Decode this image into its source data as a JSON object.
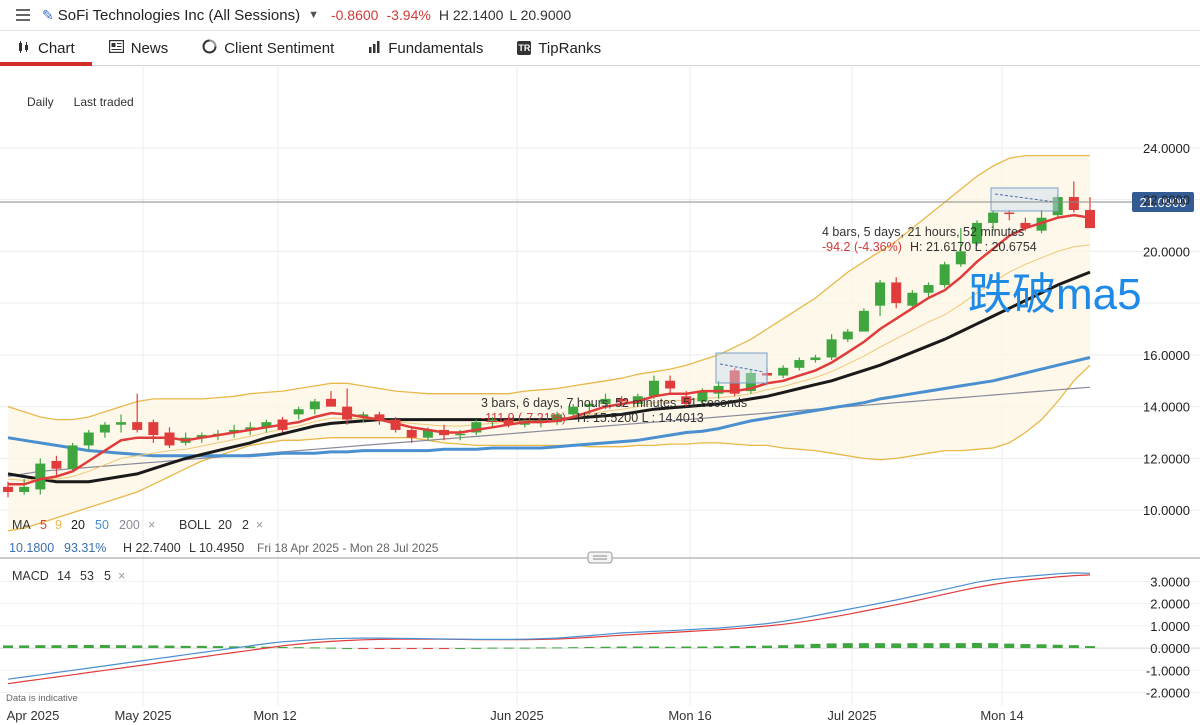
{
  "header": {
    "title": "SoFi Technologies Inc (All Sessions)",
    "change": "-0.8600",
    "change_pct": "-3.94%",
    "high": "H 22.1400",
    "low": "L 20.9000"
  },
  "tabs": [
    {
      "label": "Chart",
      "icon": "candlestick-icon"
    },
    {
      "label": "News",
      "icon": "newspaper-icon"
    },
    {
      "label": "Client Sentiment",
      "icon": "sentiment-gauge-icon"
    },
    {
      "label": "Fundamentals",
      "icon": "bar-chart-icon"
    },
    {
      "label": "TipRanks",
      "icon": "tipranks-logo-icon"
    }
  ],
  "controls": {
    "interval": "Daily",
    "price_type": "Last traded"
  },
  "price_label": "21.0900",
  "y_ticks": [
    "24.0000",
    "22.0000",
    "20.0000",
    "16.0000",
    "14.0000",
    "12.0000",
    "10.0000"
  ],
  "x_ticks": [
    "Apr 2025",
    "May 2025",
    "Mon 12",
    "Jun 2025",
    "Mon 16",
    "Jul 2025",
    "Mon 14"
  ],
  "legend": {
    "ma_label": "MA",
    "ma_periods": [
      "5",
      "9",
      "20",
      "50",
      "200"
    ],
    "boll_label": "BOLL",
    "boll_params": [
      "20",
      "2"
    ],
    "close": "×",
    "stats_a": "10.1800",
    "stats_b": "93.31%",
    "stats_high": "H 22.7400",
    "stats_low": "L 10.4950",
    "stats_range": "Fri 18 Apr 2025 - Mon 28 Jul 2025"
  },
  "annotations": {
    "measure1": {
      "line1": "3 bars, 6 days, 7 hours, 52 minutes, 51 seconds",
      "line2a": "-111.9 (-7.21%)",
      "line2b": "H: 15.5200 L : 14.4013"
    },
    "measure2": {
      "line1": "4 bars, 5 days, 21 hours, 52 minutes",
      "line2a": "-94.2 (-4.36%)",
      "line2b": "H: 21.6170 L : 20.6754"
    },
    "overlay": "跌破ma5"
  },
  "macd": {
    "label": "MACD",
    "params": [
      "14",
      "53",
      "5"
    ],
    "close": "×",
    "ticks": [
      "3.0000",
      "2.0000",
      "1.0000",
      "0.0000",
      "-1.0000",
      "-2.0000"
    ]
  },
  "footer_note": "Data is indicative",
  "chart_data": {
    "type": "candlestick",
    "price_ylim": [
      9,
      25
    ],
    "macd_ylim": [
      -2.2,
      3.6
    ],
    "colors": {
      "up": "#3fa63f",
      "down": "#e03c3c",
      "ma5": "#e03c3c",
      "ma9": "#e8b84a",
      "ma20": "#1a1a1a",
      "ma50": "#4a8fd0",
      "ma200": "#8a8a9a",
      "boll": "#e8b84a"
    },
    "candles": [
      {
        "o": 10.9,
        "h": 11.1,
        "l": 10.5,
        "c": 10.7
      },
      {
        "o": 10.7,
        "h": 11.2,
        "l": 10.6,
        "c": 10.9
      },
      {
        "o": 10.8,
        "h": 12.0,
        "l": 10.6,
        "c": 11.8
      },
      {
        "o": 11.9,
        "h": 12.1,
        "l": 11.3,
        "c": 11.6
      },
      {
        "o": 11.6,
        "h": 12.6,
        "l": 11.5,
        "c": 12.5
      },
      {
        "o": 12.5,
        "h": 13.1,
        "l": 12.3,
        "c": 13.0
      },
      {
        "o": 13.0,
        "h": 13.4,
        "l": 12.8,
        "c": 13.3
      },
      {
        "o": 13.3,
        "h": 13.7,
        "l": 13.0,
        "c": 13.4
      },
      {
        "o": 13.4,
        "h": 14.5,
        "l": 13.0,
        "c": 13.1
      },
      {
        "o": 13.4,
        "h": 13.5,
        "l": 12.6,
        "c": 12.9
      },
      {
        "o": 13.0,
        "h": 13.2,
        "l": 12.4,
        "c": 12.5
      },
      {
        "o": 12.6,
        "h": 13.0,
        "l": 12.5,
        "c": 12.8
      },
      {
        "o": 12.8,
        "h": 13.0,
        "l": 12.6,
        "c": 12.9
      },
      {
        "o": 12.9,
        "h": 13.1,
        "l": 12.7,
        "c": 12.95
      },
      {
        "o": 13.0,
        "h": 13.3,
        "l": 12.8,
        "c": 13.1
      },
      {
        "o": 13.1,
        "h": 13.4,
        "l": 12.9,
        "c": 13.2
      },
      {
        "o": 13.2,
        "h": 13.5,
        "l": 13.0,
        "c": 13.4
      },
      {
        "o": 13.5,
        "h": 13.6,
        "l": 13.0,
        "c": 13.1
      },
      {
        "o": 13.7,
        "h": 14.0,
        "l": 13.5,
        "c": 13.9
      },
      {
        "o": 13.9,
        "h": 14.3,
        "l": 13.7,
        "c": 14.2
      },
      {
        "o": 14.3,
        "h": 14.6,
        "l": 14.0,
        "c": 14.0
      },
      {
        "o": 14.0,
        "h": 14.7,
        "l": 13.3,
        "c": 13.5
      },
      {
        "o": 13.6,
        "h": 13.8,
        "l": 13.4,
        "c": 13.7
      },
      {
        "o": 13.7,
        "h": 13.8,
        "l": 13.3,
        "c": 13.5
      },
      {
        "o": 13.5,
        "h": 13.6,
        "l": 13.0,
        "c": 13.1
      },
      {
        "o": 13.1,
        "h": 13.2,
        "l": 12.6,
        "c": 12.8
      },
      {
        "o": 12.8,
        "h": 13.2,
        "l": 12.7,
        "c": 13.1
      },
      {
        "o": 13.1,
        "h": 13.3,
        "l": 12.7,
        "c": 12.9
      },
      {
        "o": 12.9,
        "h": 13.1,
        "l": 12.7,
        "c": 12.95
      },
      {
        "o": 13.0,
        "h": 13.5,
        "l": 12.9,
        "c": 13.4
      },
      {
        "o": 13.4,
        "h": 13.6,
        "l": 13.2,
        "c": 13.5
      },
      {
        "o": 13.5,
        "h": 13.6,
        "l": 13.2,
        "c": 13.3
      },
      {
        "o": 13.3,
        "h": 13.5,
        "l": 13.2,
        "c": 13.4
      },
      {
        "o": 13.4,
        "h": 13.5,
        "l": 13.2,
        "c": 13.45
      },
      {
        "o": 13.4,
        "h": 13.8,
        "l": 13.3,
        "c": 13.7
      },
      {
        "o": 13.7,
        "h": 14.1,
        "l": 13.6,
        "c": 14.0
      },
      {
        "o": 14.0,
        "h": 14.2,
        "l": 13.7,
        "c": 14.1
      },
      {
        "o": 14.1,
        "h": 14.5,
        "l": 13.9,
        "c": 14.3
      },
      {
        "o": 14.3,
        "h": 14.4,
        "l": 14.0,
        "c": 14.2
      },
      {
        "o": 14.1,
        "h": 14.5,
        "l": 14.0,
        "c": 14.4
      },
      {
        "o": 14.4,
        "h": 15.2,
        "l": 14.3,
        "c": 15.0
      },
      {
        "o": 15.0,
        "h": 15.2,
        "l": 14.5,
        "c": 14.7
      },
      {
        "o": 14.4,
        "h": 14.6,
        "l": 14.0,
        "c": 14.1
      },
      {
        "o": 14.2,
        "h": 14.7,
        "l": 14.1,
        "c": 14.6
      },
      {
        "o": 14.5,
        "h": 15.0,
        "l": 14.3,
        "c": 14.8
      },
      {
        "o": 15.4,
        "h": 15.5,
        "l": 14.4,
        "c": 14.5
      },
      {
        "o": 14.6,
        "h": 15.4,
        "l": 14.5,
        "c": 15.3
      },
      {
        "o": 15.3,
        "h": 15.5,
        "l": 15.0,
        "c": 15.2
      },
      {
        "o": 15.2,
        "h": 15.6,
        "l": 15.1,
        "c": 15.5
      },
      {
        "o": 15.5,
        "h": 15.9,
        "l": 15.4,
        "c": 15.8
      },
      {
        "o": 15.8,
        "h": 16.0,
        "l": 15.7,
        "c": 15.9
      },
      {
        "o": 15.9,
        "h": 16.8,
        "l": 15.8,
        "c": 16.6
      },
      {
        "o": 16.6,
        "h": 17.0,
        "l": 16.5,
        "c": 16.9
      },
      {
        "o": 16.9,
        "h": 17.8,
        "l": 16.9,
        "c": 17.7
      },
      {
        "o": 17.9,
        "h": 18.9,
        "l": 17.5,
        "c": 18.8
      },
      {
        "o": 18.8,
        "h": 19.0,
        "l": 17.8,
        "c": 18.0
      },
      {
        "o": 17.9,
        "h": 18.5,
        "l": 17.8,
        "c": 18.4
      },
      {
        "o": 18.4,
        "h": 18.8,
        "l": 18.2,
        "c": 18.7
      },
      {
        "o": 18.7,
        "h": 19.6,
        "l": 18.6,
        "c": 19.5
      },
      {
        "o": 19.5,
        "h": 20.9,
        "l": 19.4,
        "c": 20.0
      },
      {
        "o": 20.3,
        "h": 21.2,
        "l": 20.2,
        "c": 21.1
      },
      {
        "o": 21.1,
        "h": 21.6,
        "l": 20.8,
        "c": 21.5
      },
      {
        "o": 21.5,
        "h": 21.6,
        "l": 21.2,
        "c": 21.45
      },
      {
        "o": 21.1,
        "h": 21.3,
        "l": 20.8,
        "c": 20.9
      },
      {
        "o": 20.8,
        "h": 21.6,
        "l": 20.7,
        "c": 21.3
      },
      {
        "o": 21.4,
        "h": 22.2,
        "l": 21.3,
        "c": 22.1
      },
      {
        "o": 22.1,
        "h": 22.7,
        "l": 21.5,
        "c": 21.6
      },
      {
        "o": 21.6,
        "h": 22.1,
        "l": 20.9,
        "c": 20.9
      }
    ],
    "ma5": [
      11.0,
      11.0,
      11.2,
      11.3,
      11.5,
      11.9,
      12.3,
      12.7,
      12.8,
      12.8,
      12.8,
      12.7,
      12.8,
      12.9,
      13.0,
      13.1,
      13.2,
      13.3,
      13.4,
      13.6,
      13.75,
      13.7,
      13.6,
      13.5,
      13.35,
      13.2,
      13.1,
      13.0,
      13.0,
      13.1,
      13.2,
      13.3,
      13.4,
      13.4,
      13.45,
      13.6,
      13.8,
      14.0,
      14.1,
      14.2,
      14.4,
      14.5,
      14.5,
      14.6,
      14.6,
      14.6,
      14.7,
      14.9,
      15.0,
      15.2,
      15.4,
      15.7,
      16.1,
      16.5,
      17.0,
      17.4,
      17.8,
      18.2,
      18.5,
      19.0,
      19.6,
      20.1,
      20.6,
      20.9,
      21.1,
      21.3,
      21.4,
      21.3
    ],
    "ma20": [
      11.4,
      11.3,
      11.2,
      11.1,
      11.1,
      11.1,
      11.2,
      11.3,
      11.4,
      11.6,
      11.8,
      12.0,
      12.15,
      12.3,
      12.45,
      12.6,
      12.8,
      12.95,
      13.1,
      13.25,
      13.35,
      13.4,
      13.45,
      13.5,
      13.5,
      13.5,
      13.5,
      13.5,
      13.5,
      13.5,
      13.5,
      13.5,
      13.5,
      13.5,
      13.5,
      13.55,
      13.6,
      13.65,
      13.7,
      13.8,
      13.9,
      13.95,
      14.0,
      14.05,
      14.1,
      14.2,
      14.3,
      14.4,
      14.55,
      14.7,
      14.85,
      15.0,
      15.2,
      15.4,
      15.6,
      15.85,
      16.1,
      16.35,
      16.6,
      16.9,
      17.2,
      17.5,
      17.8,
      18.1,
      18.4,
      18.7,
      18.95,
      19.2
    ],
    "ma50": [
      12.8,
      12.7,
      12.6,
      12.5,
      12.4,
      12.3,
      12.25,
      12.2,
      12.15,
      12.1,
      12.1,
      12.1,
      12.1,
      12.1,
      12.1,
      12.1,
      12.15,
      12.2,
      12.2,
      12.2,
      12.25,
      12.25,
      12.3,
      12.3,
      12.3,
      12.3,
      12.3,
      12.35,
      12.35,
      12.35,
      12.4,
      12.4,
      12.4,
      12.4,
      12.45,
      12.5,
      12.55,
      12.6,
      12.65,
      12.7,
      12.8,
      12.9,
      13.0,
      13.05,
      13.15,
      13.3,
      13.45,
      13.55,
      13.65,
      13.75,
      13.85,
      13.95,
      14.05,
      14.15,
      14.3,
      14.4,
      14.5,
      14.6,
      14.7,
      14.8,
      14.9,
      15.0,
      15.15,
      15.3,
      15.45,
      15.6,
      15.75,
      15.9
    ],
    "ma200": [
      11.3,
      11.4,
      11.5,
      11.55,
      11.6,
      11.65,
      11.7,
      11.75,
      11.8,
      11.85,
      11.9,
      11.95,
      12.0,
      12.05,
      12.1,
      12.15,
      12.2,
      12.25,
      12.3,
      12.35,
      12.4,
      12.45,
      12.5,
      12.55,
      12.6,
      12.65,
      12.7,
      12.75,
      12.8,
      12.85,
      12.9,
      12.95,
      13.0,
      13.05,
      13.1,
      13.15,
      13.2,
      13.25,
      13.3,
      13.35,
      13.4,
      13.45,
      13.5,
      13.55,
      13.6,
      13.65,
      13.7,
      13.75,
      13.8,
      13.85,
      13.9,
      13.95,
      14.0,
      14.05,
      14.1,
      14.15,
      14.2,
      14.25,
      14.3,
      14.35,
      14.4,
      14.45,
      14.5,
      14.55,
      14.6,
      14.65,
      14.7,
      14.75
    ],
    "boll_upper": [
      14.0,
      13.8,
      13.6,
      13.5,
      13.5,
      13.6,
      13.8,
      14.0,
      14.2,
      14.3,
      14.3,
      14.3,
      14.3,
      14.35,
      14.4,
      14.5,
      14.55,
      14.6,
      14.7,
      14.8,
      14.9,
      14.9,
      14.8,
      14.7,
      14.6,
      14.55,
      14.5,
      14.5,
      14.5,
      14.5,
      14.5,
      14.5,
      14.6,
      14.65,
      14.7,
      14.8,
      14.9,
      15.0,
      15.1,
      15.25,
      15.35,
      15.45,
      15.6,
      15.8,
      16.0,
      16.3,
      16.6,
      17.0,
      17.4,
      17.8,
      18.2,
      18.7,
      19.2,
      19.6,
      20.0,
      20.4,
      20.9,
      21.4,
      21.9,
      22.4,
      22.9,
      23.3,
      23.6,
      23.7,
      23.7,
      23.7,
      23.7,
      23.7
    ],
    "boll_lower": [
      9.2,
      9.3,
      9.5,
      9.7,
      9.9,
      10.1,
      10.3,
      10.5,
      10.7,
      11.0,
      11.3,
      11.6,
      11.9,
      12.1,
      12.3,
      12.5,
      12.6,
      12.7,
      12.7,
      12.75,
      12.8,
      12.8,
      12.8,
      12.8,
      12.8,
      12.8,
      12.7,
      12.6,
      12.55,
      12.5,
      12.5,
      12.5,
      12.5,
      12.5,
      12.5,
      12.5,
      12.45,
      12.45,
      12.45,
      12.5,
      12.5,
      12.55,
      12.55,
      12.6,
      12.6,
      12.55,
      12.5,
      12.5,
      12.4,
      12.35,
      12.3,
      12.2,
      12.1,
      12.0,
      11.95,
      12.0,
      12.1,
      12.2,
      12.3,
      12.3,
      12.35,
      12.4,
      12.6,
      13.0,
      13.5,
      14.2,
      15.0,
      15.6
    ],
    "macd_line": [
      -1.4,
      -1.3,
      -1.2,
      -1.1,
      -1.0,
      -0.9,
      -0.8,
      -0.7,
      -0.6,
      -0.5,
      -0.4,
      -0.3,
      -0.2,
      -0.1,
      0.0,
      0.1,
      0.2,
      0.28,
      0.33,
      0.38,
      0.42,
      0.44,
      0.45,
      0.45,
      0.44,
      0.43,
      0.42,
      0.41,
      0.4,
      0.39,
      0.39,
      0.39,
      0.4,
      0.42,
      0.45,
      0.5,
      0.56,
      0.62,
      0.68,
      0.72,
      0.75,
      0.78,
      0.82,
      0.86,
      0.9,
      0.96,
      1.03,
      1.1,
      1.2,
      1.32,
      1.46,
      1.6,
      1.74,
      1.88,
      2.02,
      2.16,
      2.32,
      2.48,
      2.64,
      2.8,
      2.96,
      3.08,
      3.16,
      3.22,
      3.28,
      3.34,
      3.38,
      3.36
    ],
    "signal_line": [
      -1.6,
      -1.5,
      -1.4,
      -1.3,
      -1.2,
      -1.1,
      -1.0,
      -0.9,
      -0.8,
      -0.7,
      -0.6,
      -0.5,
      -0.4,
      -0.3,
      -0.2,
      -0.1,
      0.0,
      0.1,
      0.18,
      0.25,
      0.3,
      0.34,
      0.37,
      0.39,
      0.4,
      0.4,
      0.4,
      0.4,
      0.39,
      0.38,
      0.38,
      0.38,
      0.38,
      0.39,
      0.41,
      0.44,
      0.48,
      0.53,
      0.58,
      0.62,
      0.66,
      0.7,
      0.74,
      0.78,
      0.82,
      0.87,
      0.93,
      0.99,
      1.07,
      1.16,
      1.27,
      1.39,
      1.52,
      1.66,
      1.8,
      1.95,
      2.1,
      2.26,
      2.42,
      2.58,
      2.73,
      2.86,
      2.97,
      3.06,
      3.13,
      3.2,
      3.26,
      3.29
    ],
    "histogram": [
      0.12,
      0.12,
      0.13,
      0.13,
      0.14,
      0.14,
      0.14,
      0.13,
      0.12,
      0.12,
      0.11,
      0.1,
      0.1,
      0.09,
      0.08,
      0.07,
      0.06,
      0.05,
      0.04,
      0.03,
      0.02,
      0.0,
      -0.02,
      -0.03,
      -0.04,
      -0.03,
      -0.02,
      -0.01,
      0.0,
      0.01,
      0.02,
      0.02,
      0.02,
      0.03,
      0.03,
      0.04,
      0.05,
      0.06,
      0.07,
      0.07,
      0.07,
      0.06,
      0.07,
      0.07,
      0.08,
      0.09,
      0.1,
      0.11,
      0.13,
      0.16,
      0.19,
      0.21,
      0.22,
      0.22,
      0.22,
      0.21,
      0.22,
      0.22,
      0.22,
      0.22,
      0.23,
      0.22,
      0.2,
      0.18,
      0.17,
      0.15,
      0.13,
      0.09
    ]
  }
}
